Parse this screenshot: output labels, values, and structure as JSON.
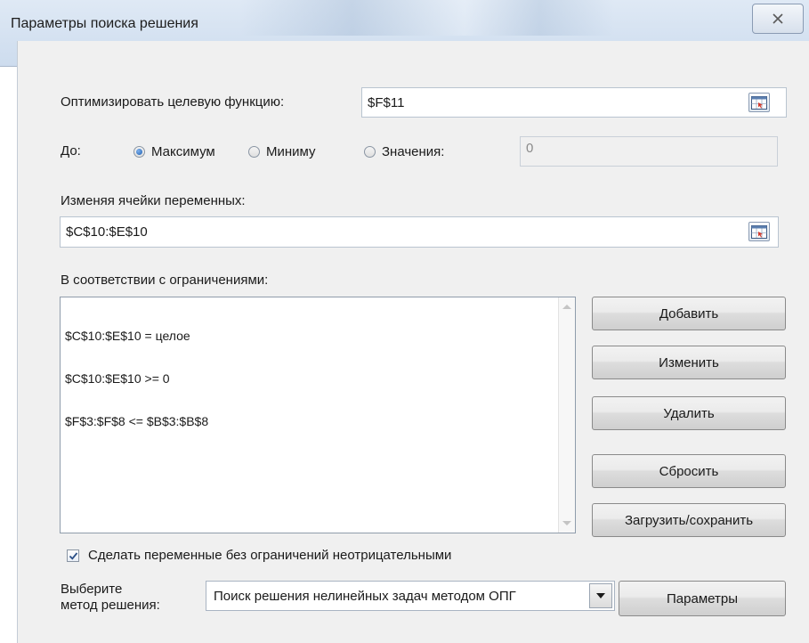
{
  "window": {
    "title": "Параметры поиска решения"
  },
  "objective": {
    "label": "Оптимизировать целевую функцию:",
    "value": "$F$11"
  },
  "to": {
    "label": "До:",
    "options": [
      {
        "label": "Максимум",
        "selected": true
      },
      {
        "label": "Миниму",
        "selected": false
      },
      {
        "label": "Значения:",
        "selected": false
      }
    ],
    "value": "0"
  },
  "variables": {
    "label": "Изменяя ячейки переменных:",
    "value": "$C$10:$E$10"
  },
  "constraints": {
    "label": "В соответствии с ограничениями:",
    "items": [
      "$C$10:$E$10 = целое",
      "$C$10:$E$10 >= 0",
      "$F$3:$F$8 <= $B$3:$B$8"
    ]
  },
  "buttons": {
    "add": "Добавить",
    "change": "Изменить",
    "delete": "Удалить",
    "reset": "Сбросить",
    "load_save": "Загрузить/сохранить"
  },
  "nonneg": {
    "label": "Сделать переменные без ограничений неотрицательными",
    "checked": true
  },
  "method": {
    "label_line1": "Выберите",
    "label_line2": "метод решения:",
    "value": "Поиск решения нелинейных задач методом ОПГ"
  },
  "options_button": "Параметры",
  "icons": {
    "close": "close-icon",
    "collapse": "range-select-icon",
    "check": "check-icon",
    "dropdown": "chevron-down-icon"
  }
}
